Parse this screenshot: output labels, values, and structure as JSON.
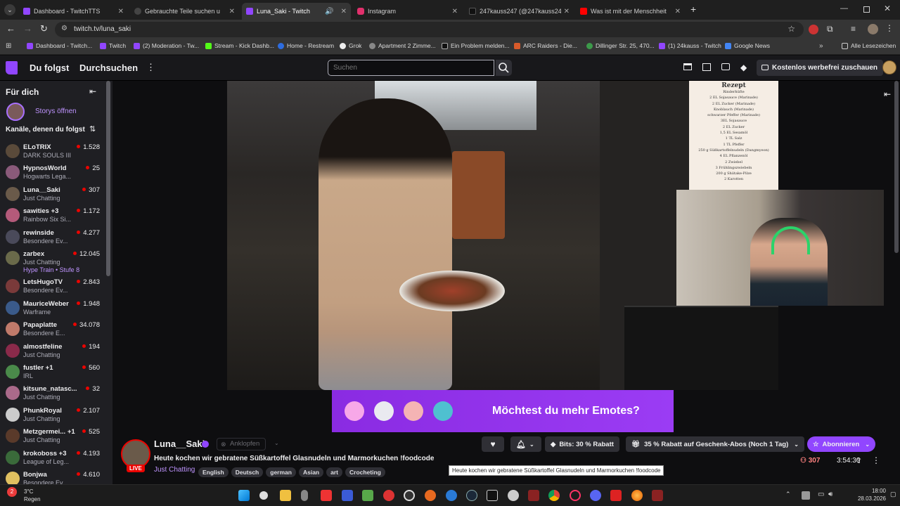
{
  "browser": {
    "tabs": [
      {
        "title": "Dashboard - TwitchTTS",
        "color": "#9146ff"
      },
      {
        "title": "Gebrauchte Teile suchen u",
        "color": "#444"
      },
      {
        "title": "Luna_Saki - Twitch",
        "color": "#9146ff"
      },
      {
        "title": "Instagram",
        "color": "#e1306c"
      },
      {
        "title": "247kauss247 (@247kauss247) |",
        "color": "#111"
      },
      {
        "title": "Was ist mit der Menschheit los",
        "color": "#ff0000"
      }
    ],
    "url": "twitch.tv/luna_saki",
    "bookmarks": [
      "Dashboard - Twitch...",
      "Twitch",
      "(2) Moderation - Tw...",
      "Stream - Kick Dashb...",
      "Home - Restream",
      "Grok",
      "Apartment 2 Zimme...",
      "Ein Problem melden...",
      "ARC Raiders - Die...",
      "Dillinger Str. 25, 470...",
      "(1) 24kauss - Twitch",
      "Google News"
    ],
    "all_bookmarks": "Alle Lesezeichen"
  },
  "twitch": {
    "nav": {
      "following": "Du folgst",
      "browse": "Durchsuchen",
      "more": "⋮"
    },
    "search_placeholder": "Suchen",
    "adfree": "Kostenlos werbefrei zuschauen",
    "sidebar": {
      "for_you": "Für dich",
      "stories": "Storys öffnen",
      "followed_header": "Kanäle, denen du folgst",
      "channels": [
        {
          "name": "ELoTRIX",
          "game": "DARK SOULS III",
          "viewers": "1.528",
          "color": "#5a4a3a"
        },
        {
          "name": "HypnosWorld",
          "game": "Hogwarts Lega...",
          "viewers": "25",
          "color": "#8a5a7a"
        },
        {
          "name": "Luna__Saki",
          "game": "Just Chatting",
          "viewers": "307",
          "color": "#6a5a4a"
        },
        {
          "name": "sawities +3",
          "game": "Rainbow Six Si...",
          "viewers": "1.172",
          "color": "#b45a7a"
        },
        {
          "name": "rewinside",
          "game": "Besondere Ev...",
          "viewers": "4.277",
          "color": "#4a4a5a"
        },
        {
          "name": "zarbex",
          "game": "Just Chatting",
          "viewers": "12.045",
          "color": "#6a6a4a"
        },
        {
          "name": "LetsHugoTV",
          "game": "Besondere Ev...",
          "viewers": "2.843",
          "color": "#7a3a3a"
        },
        {
          "name": "MauriceWeber",
          "game": "Warframe",
          "viewers": "1.948",
          "color": "#3a5a8a"
        },
        {
          "name": "Papaplatte",
          "game": "Besondere E...",
          "viewers": "34.078",
          "color": "#c07a6a"
        },
        {
          "name": "almostfeline",
          "game": "Just Chatting",
          "viewers": "194",
          "color": "#8a2a4a"
        },
        {
          "name": "fustler +1",
          "game": "IRL",
          "viewers": "560",
          "color": "#4a8a4a"
        },
        {
          "name": "kitsune_natasc...",
          "game": "Just Chatting",
          "viewers": "32",
          "color": "#aa6a8a"
        },
        {
          "name": "PhunkRoyal",
          "game": "Just Chatting",
          "viewers": "2.107",
          "color": "#ccc"
        },
        {
          "name": "Metzgermei... +1",
          "game": "Just Chatting",
          "viewers": "525",
          "color": "#5a3a2a"
        },
        {
          "name": "krokoboss +3",
          "game": "League of Leg...",
          "viewers": "4.193",
          "color": "#3a6a3a"
        },
        {
          "name": "Bonjwa",
          "game": "Besondere Ev...",
          "viewers": "4.610",
          "color": "#e0c060"
        }
      ],
      "hype_train": "Hype Train • Stufe 8"
    },
    "overlay": {
      "recipe_title": "Rezept",
      "recipe_lines": [
        "Rinderhüfte",
        "2 EL Sojasauce (Marinade)",
        "2 EL Zucker (Marinade)",
        "Knoblauch (Marinade)",
        "schwarzer Pfeffer (Marinade)",
        "3EL Sojasauce",
        "2 EL Zucker",
        "1,5 EL Sesamöl",
        "1 TL Salz",
        "1 TL Pfeffer",
        "250 g Süßkartoffelnudeln (Dangmyeon)",
        "4 EL Pflanzenöl",
        "2 Zwiebel",
        "3 Frühlingszwiebeln",
        "200 g Shiitake-Pilze",
        "2 Karotten"
      ],
      "emote_banner": "Möchtest du mehr Emotes?"
    },
    "stream": {
      "channel": "Luna__Saki",
      "knock": "Anklopfen",
      "title": "Heute kochen wir gebratene Süßkartoffel Glasnudeln und Marmorkuchen !foodcode",
      "category": "Just Chatting",
      "tags": [
        "English",
        "Deutsch",
        "german",
        "Asian",
        "art",
        "Crocheting"
      ],
      "live": "LIVE",
      "bits": "Bits: 30 % Rabatt",
      "gift": "35 % Rabatt auf Geschenk-Abos (Noch 1 Tag)",
      "subscribe": "Abonnieren",
      "viewers": "307",
      "uptime": "3:54:30",
      "tooltip": "Heute kochen wir gebratene Süßkartoffel Glasnudeln und Marmorkuchen !foodcode"
    }
  },
  "taskbar": {
    "weather_temp": "3°C",
    "weather_desc": "Regen",
    "time": "18:00",
    "date": "28.03.2026",
    "notif": "2"
  }
}
